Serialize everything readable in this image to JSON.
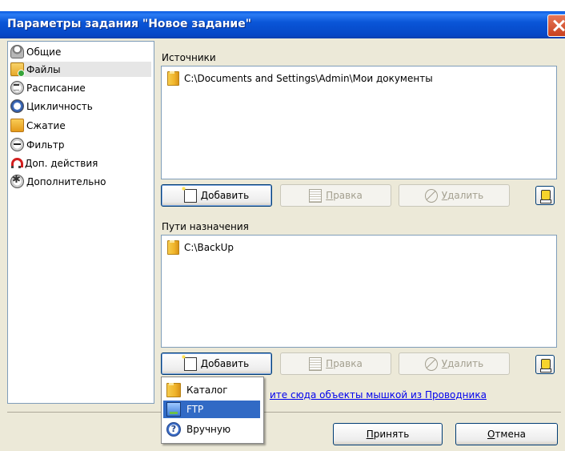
{
  "window": {
    "title": "Параметры задания \"Новое задание\""
  },
  "sidebar": {
    "items": [
      {
        "label": "Общие",
        "icon": "user-icon"
      },
      {
        "label": "Файлы",
        "icon": "files-icon"
      },
      {
        "label": "Расписание",
        "icon": "clock-icon"
      },
      {
        "label": "Цикличность",
        "icon": "cycle-icon"
      },
      {
        "label": "Сжатие",
        "icon": "archive-icon"
      },
      {
        "label": "Фильтр",
        "icon": "filter-icon"
      },
      {
        "label": "Доп. действия",
        "icon": "magnet-icon"
      },
      {
        "label": "Дополнительно",
        "icon": "gear-icon"
      }
    ]
  },
  "sources": {
    "label": "Источники",
    "items": [
      "C:\\Documents and Settings\\Admin\\Мои документы"
    ],
    "add_first": "Д",
    "add_rest": "обавить",
    "edit_first": "П",
    "edit_rest": "равка",
    "delete_first": "У",
    "delete_rest": "далить"
  },
  "destinations": {
    "label": "Пути назначения",
    "items": [
      "C:\\BackUp"
    ],
    "add_first": "Д",
    "add_rest": "обавить",
    "edit_first": "П",
    "edit_rest": "равка",
    "delete_first": "У",
    "delete_rest": "далить"
  },
  "drag_hint": "ите сюда объекты мышкой из Проводника",
  "add_menu": {
    "items": [
      {
        "label": "Каталог",
        "icon": "folder-icon"
      },
      {
        "label": "FTP",
        "icon": "ftp-icon"
      },
      {
        "label": "Вручную",
        "icon": "help-icon"
      }
    ]
  },
  "footer": {
    "ok_first": "П",
    "ok_rest": "ринять",
    "cancel_first": "О",
    "cancel_rest": "тмена"
  }
}
